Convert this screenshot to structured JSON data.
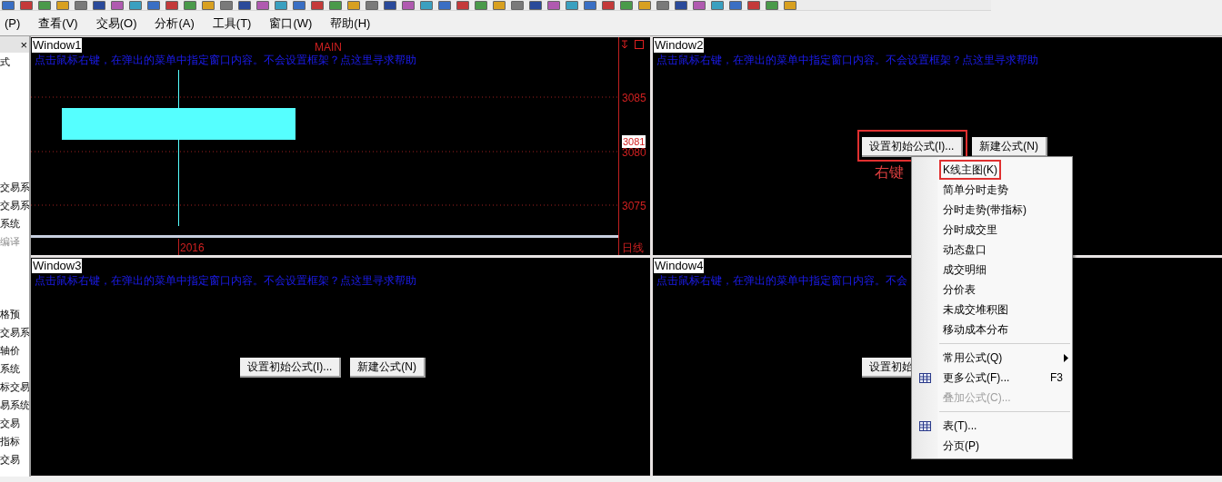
{
  "menu_bar": [
    "(P)",
    "查看(V)",
    "交易(O)",
    "分析(A)",
    "工具(T)",
    "窗口(W)",
    "帮助(H)"
  ],
  "side_panel": {
    "close_icon": "×",
    "lines": [
      {
        "text": "式",
        "disabled": false
      },
      {
        "text": "交易系",
        "disabled": false
      },
      {
        "text": "交易系",
        "disabled": false
      },
      {
        "text": "系统",
        "disabled": false
      },
      {
        "text": "编译",
        "disabled": true
      },
      {
        "text": "格预",
        "disabled": false
      },
      {
        "text": "交易系",
        "disabled": false
      },
      {
        "text": "轴价",
        "disabled": false
      },
      {
        "text": "系统",
        "disabled": false
      },
      {
        "text": "标交易",
        "disabled": false
      },
      {
        "text": "易系统",
        "disabled": false
      },
      {
        "text": "交易",
        "disabled": false
      },
      {
        "text": "指标",
        "disabled": false
      },
      {
        "text": "交易",
        "disabled": false
      }
    ]
  },
  "windows": [
    {
      "kind": "chart",
      "title": "Window1",
      "hint": "点击鼠标右键，在弹出的菜单中指定窗口内容。不会设置框架？点这里寻求帮助",
      "chart": {
        "label": "MAIN",
        "price_labels": [
          "3085",
          "3080",
          "3075"
        ],
        "last_price": "3081",
        "date_label": "2016",
        "period": "日线"
      }
    },
    {
      "kind": "blank",
      "title": "Window2",
      "hint": "点击鼠标右键，在弹出的菜单中指定窗口内容。不会设置框架？点这里寻求帮助",
      "buttons": [
        {
          "label": "设置初始公式(I)...",
          "outlined": true
        },
        {
          "label": "新建公式(N)",
          "outlined": false
        }
      ]
    },
    {
      "kind": "blank",
      "title": "Window3",
      "hint": "点击鼠标右键，在弹出的菜单中指定窗口内容。不会设置框架？点这里寻求帮助",
      "buttons": [
        {
          "label": "设置初始公式(I)...",
          "outlined": false
        },
        {
          "label": "新建公式(N)",
          "outlined": false
        }
      ]
    },
    {
      "kind": "blank",
      "title": "Window4",
      "hint": "点击鼠标右键，在弹出的菜单中指定窗口内容。不会",
      "buttons": [
        {
          "label": "设置初始",
          "outlined": false
        }
      ]
    }
  ],
  "annotation": "右键",
  "context_menu": [
    {
      "kind": "item",
      "label": "K线主图(K)",
      "outlined": true,
      "disabled": false
    },
    {
      "kind": "item",
      "label": "简单分时走势",
      "outlined": false,
      "disabled": false
    },
    {
      "kind": "item",
      "label": "分时走势(带指标)",
      "outlined": false,
      "disabled": false
    },
    {
      "kind": "item",
      "label": "分时成交里",
      "outlined": false,
      "disabled": false
    },
    {
      "kind": "item",
      "label": "动态盘口",
      "outlined": false,
      "disabled": false
    },
    {
      "kind": "item",
      "label": "成交明细",
      "outlined": false,
      "disabled": false
    },
    {
      "kind": "item",
      "label": "分价表",
      "outlined": false,
      "disabled": false
    },
    {
      "kind": "item",
      "label": "未成交堆积图",
      "outlined": false,
      "disabled": false
    },
    {
      "kind": "item",
      "label": "移动成本分布",
      "outlined": false,
      "disabled": false
    },
    {
      "kind": "separator"
    },
    {
      "kind": "submenu",
      "label": "常用公式(Q)",
      "outlined": false,
      "disabled": false
    },
    {
      "kind": "icon_item",
      "label": "更多公式(F)...",
      "shortcut": "F3",
      "outlined": false,
      "disabled": false
    },
    {
      "kind": "item",
      "label": "叠加公式(C)...",
      "outlined": false,
      "disabled": true
    },
    {
      "kind": "separator"
    },
    {
      "kind": "icon_item",
      "label": "表(T)...",
      "outlined": false,
      "disabled": false
    },
    {
      "kind": "item",
      "label": "分页(P)",
      "outlined": false,
      "disabled": false
    }
  ]
}
